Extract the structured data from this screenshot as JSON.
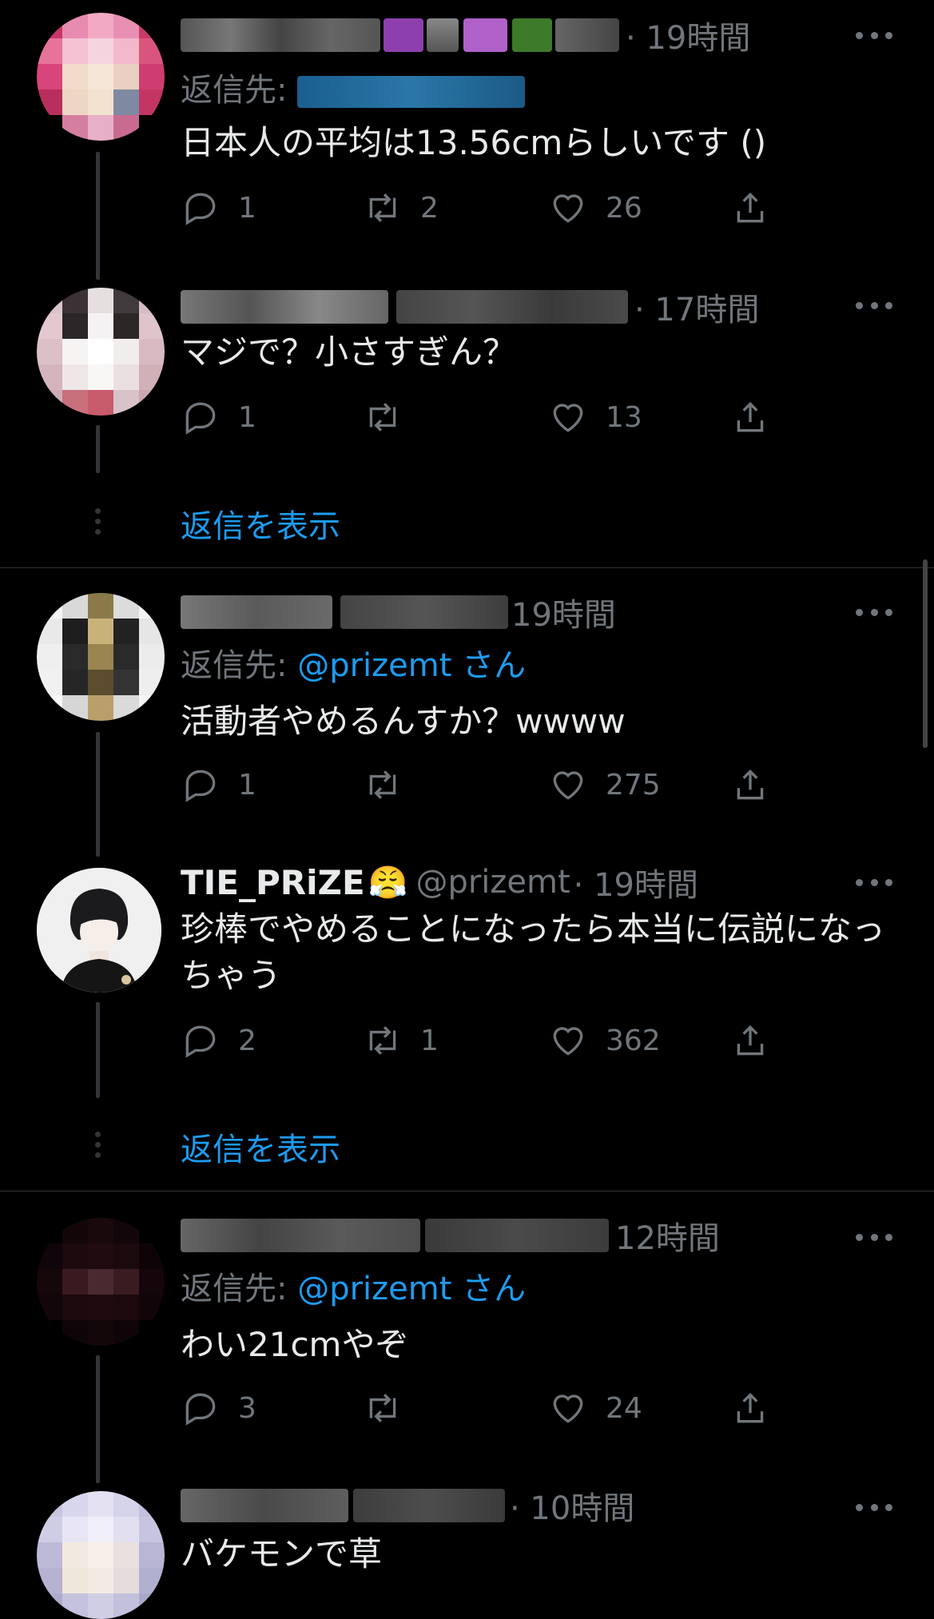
{
  "colors": {
    "background": "#000000",
    "text": "#e7e9ea",
    "muted": "#71767b",
    "accent": "#1d9bf0",
    "divider": "#2f3336"
  },
  "tweets": [
    {
      "time": "· 19時間",
      "reply_label": "返信先:",
      "reply_to": "",
      "text": "日本人の平均は13.56cmらしいです ()",
      "replies": "1",
      "retweets": "2",
      "likes": "26"
    },
    {
      "time": "· 17時間",
      "text": "マジで？小さすぎん？",
      "replies": "1",
      "retweets": "",
      "likes": "13"
    },
    {
      "time": "19時間",
      "reply_label": "返信先:",
      "reply_to": "@prizemt さん",
      "text": "活動者やめるんすか？wwww",
      "replies": "1",
      "retweets": "",
      "likes": "275"
    },
    {
      "name": "TIE_PRiZE",
      "emoji": "😤",
      "handle": "@prizemt",
      "time": "· 19時間",
      "text": "珍棒でやめることになったら本当に伝説になっちゃう",
      "replies": "2",
      "retweets": "1",
      "likes": "362"
    },
    {
      "time": "12時間",
      "reply_label": "返信先:",
      "reply_to": "@prizemt さん",
      "text": "わい21cmやぞ",
      "replies": "3",
      "retweets": "",
      "likes": "24"
    },
    {
      "time": "· 10時間",
      "text": "バケモンで草"
    }
  ],
  "show_replies": [
    "返信を表示",
    "返信を表示"
  ],
  "icons": {
    "reply": "reply-icon",
    "retweet": "retweet-icon",
    "like": "heart-icon",
    "share": "share-icon",
    "more": "more-icon"
  }
}
